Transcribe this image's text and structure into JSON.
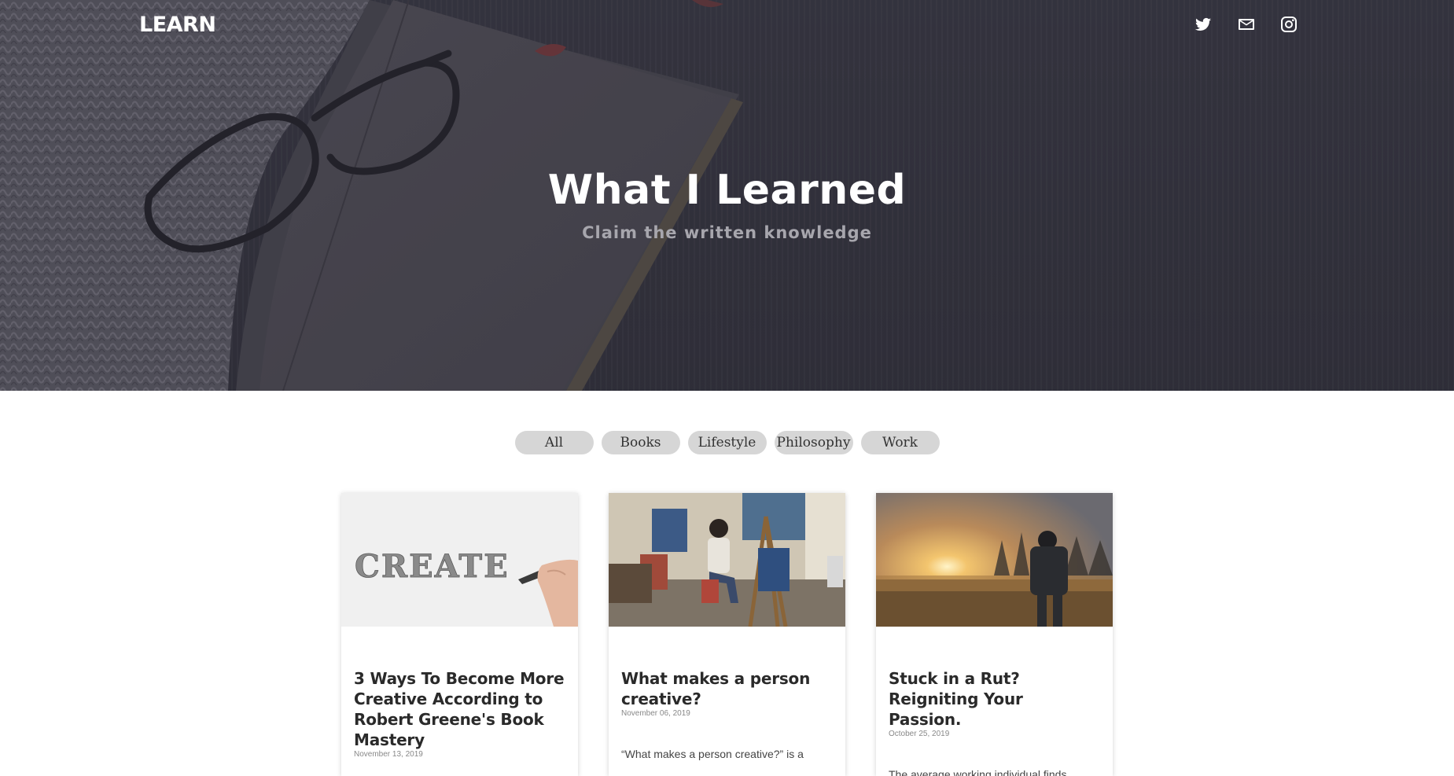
{
  "header": {
    "logo": "LEARN",
    "social": [
      {
        "name": "twitter-icon",
        "label": "Twitter"
      },
      {
        "name": "mail-icon",
        "label": "Email"
      },
      {
        "name": "instagram-icon",
        "label": "Instagram"
      }
    ]
  },
  "hero": {
    "title": "What I Learned",
    "subtitle": "Claim the written knowledge"
  },
  "filters": [
    "All",
    "Books",
    "Lifestyle",
    "Philosophy",
    "Work"
  ],
  "posts": [
    {
      "title": "3 Ways To Become More Creative According to Robert Greene's Book Mastery",
      "date": "November 13, 2019",
      "excerpt": "",
      "image_text": "CREATE"
    },
    {
      "title": "What makes a person creative?",
      "date": "November 06, 2019",
      "excerpt": "“What makes a person creative?” is a"
    },
    {
      "title": "Stuck in a Rut? Reigniting Your Passion.",
      "date": "October 25, 2019",
      "excerpt": "The average working individual finds"
    }
  ],
  "colors": {
    "hero_bg": "#3b3a45",
    "filter_bg": "#d6d6d6",
    "title_text": "#2a2a2a"
  }
}
